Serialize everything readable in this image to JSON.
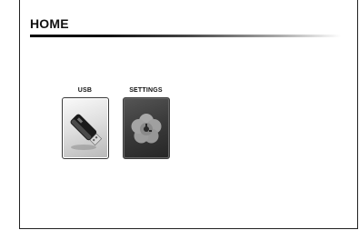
{
  "header": {
    "title": "HOME"
  },
  "apps": [
    {
      "label": "USB",
      "icon": "usb-drive-icon"
    },
    {
      "label": "SETTINGS",
      "icon": "gear-flower-icon"
    }
  ]
}
